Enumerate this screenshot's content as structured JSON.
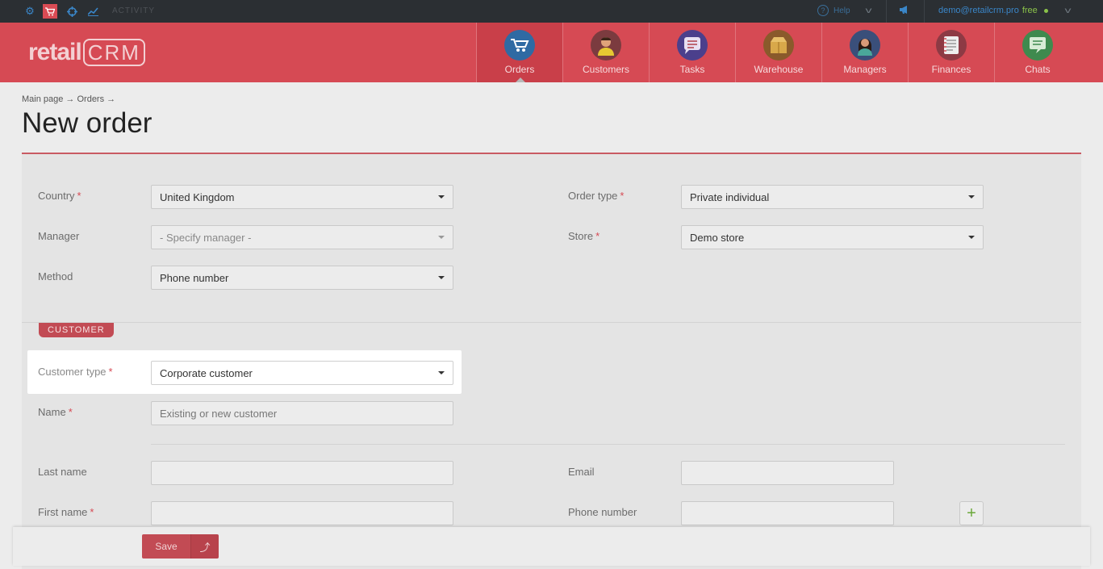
{
  "topbar": {
    "icons": [
      "gear-icon",
      "cart-icon",
      "crosshair-icon",
      "activity-chart-icon"
    ],
    "activity_label": "ACTIVITY",
    "help_label": "Help",
    "help_icon": "?",
    "user_email": "demo@retailcrm.pro",
    "plan_label": "free"
  },
  "brand": {
    "name_left": "retail",
    "name_right": "CRM"
  },
  "nav": {
    "items": [
      {
        "label": "Orders",
        "icon": "cart-icon",
        "color": "#2f6aa3",
        "active": true
      },
      {
        "label": "Customers",
        "icon": "person-icon",
        "color": "#7b3b3f",
        "active": false
      },
      {
        "label": "Tasks",
        "icon": "task-list-icon",
        "color": "#4b3f8c",
        "active": false
      },
      {
        "label": "Warehouse",
        "icon": "box-icon",
        "color": "#8a5a2b",
        "active": false
      },
      {
        "label": "Managers",
        "icon": "manager-icon",
        "color": "#3a4f7a",
        "active": false
      },
      {
        "label": "Finances",
        "icon": "ledger-icon",
        "color": "#8d3a44",
        "active": false
      },
      {
        "label": "Chats",
        "icon": "chat-icon",
        "color": "#3f8a4e",
        "active": false
      }
    ]
  },
  "breadcrumb": "Main page → Orders →",
  "page_title": "New order",
  "form": {
    "country": {
      "label": "Country",
      "value": "United Kingdom"
    },
    "order_type": {
      "label": "Order type",
      "value": "Private individual"
    },
    "manager": {
      "label": "Manager",
      "value": "- Specify manager -"
    },
    "store": {
      "label": "Store",
      "value": "Demo store"
    },
    "method": {
      "label": "Method",
      "value": "Phone number"
    },
    "customer_section": "CUSTOMER",
    "customer_type": {
      "label": "Customer type",
      "value": "Corporate customer"
    },
    "name": {
      "label": "Name",
      "placeholder": "Existing or new customer"
    },
    "last_name": {
      "label": "Last name",
      "value": ""
    },
    "email": {
      "label": "Email",
      "value": ""
    },
    "first_name": {
      "label": "First name",
      "value": ""
    },
    "phone": {
      "label": "Phone number",
      "value": ""
    },
    "required_mark": "*"
  },
  "footer": {
    "save_label": "Save",
    "save_more_icon": "⤴"
  },
  "colors": {
    "brand": "#d64a54",
    "topbar": "#2b2f33",
    "accent_blue": "#3a86c8",
    "free_green": "#8bc34a"
  }
}
